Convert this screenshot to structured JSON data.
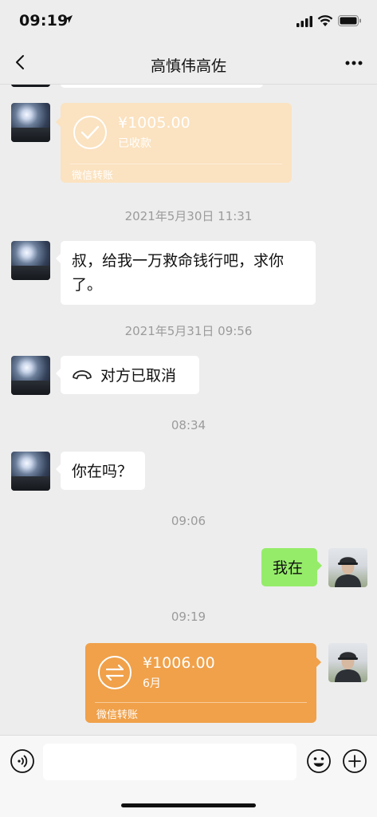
{
  "status": {
    "time": "09:19"
  },
  "nav": {
    "title": "高慎伟高佐"
  },
  "messages": {
    "transfer_received": {
      "amount": "¥1005.00",
      "status": "已收款",
      "footer": "微信转账"
    },
    "ts1": "2021年5月30日 11:31",
    "msg1_line1": "叔，给我一万救命钱行吧，求你",
    "msg1_line2": "了。",
    "ts2": "2021年5月31日 09:56",
    "call_text": "对方已取消",
    "ts3": "08:34",
    "msg2": "你在吗？",
    "ts4": "09:06",
    "msg3": "我在",
    "ts5": "09:19",
    "transfer_sent": {
      "amount": "¥1006.00",
      "note": "6月",
      "footer": "微信转账"
    }
  },
  "colors": {
    "bubble_sent": "#95ec69",
    "transfer_received_bg": "#fbe2c0",
    "transfer_sent_bg": "#f0a14a"
  },
  "icons": [
    "location-arrow-icon",
    "signal-icon",
    "wifi-icon",
    "battery-icon",
    "back-chevron-icon",
    "more-dots-icon",
    "checkmark-circle-icon",
    "phone-hangup-icon",
    "transfer-arrows-icon",
    "voice-icon",
    "emoji-icon",
    "plus-icon"
  ]
}
